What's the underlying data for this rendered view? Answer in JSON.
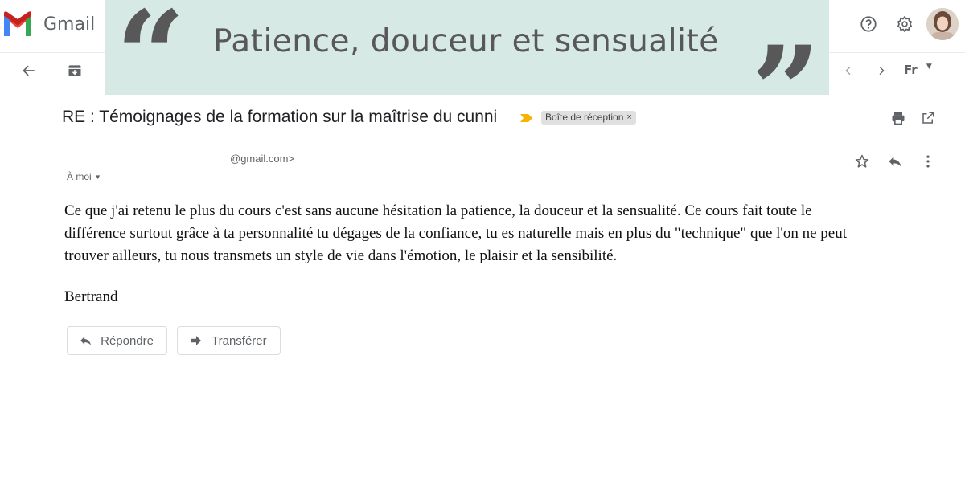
{
  "header": {
    "app_name": "Gmail",
    "language_button": "Fr"
  },
  "banner": {
    "title": "Patience, douceur et sensualité",
    "open_quote": "“",
    "close_quote": "”",
    "background_color": "#d7e9e5",
    "text_color": "#585858"
  },
  "email": {
    "subject": "RE : Témoignages de la formation sur la maîtrise du cunni",
    "label": "Boîte de réception",
    "label_remove": "×",
    "sender": "@gmail.com>",
    "recipient": "À moi",
    "body": "Ce que j'ai retenu le plus du cours c'est sans aucune hésitation la patience, la douceur et la sensualité. Ce cours fait toute le différence surtout grâce à ta personnalité tu dégages de la confiance, tu es naturelle mais en plus du \"technique\" que l'on ne peut trouver ailleurs, tu nous transmets un style de vie dans l'émotion, le plaisir et la sensibilité.",
    "signature": "Bertrand"
  },
  "actions": {
    "reply_label": "Répondre",
    "forward_label": "Transférer"
  },
  "icons": [
    "gmail-logo-icon",
    "help-icon",
    "gear-icon",
    "back-icon",
    "archive-icon",
    "chevron-left-icon",
    "chevron-right-icon",
    "important-icon",
    "print-icon",
    "open-in-new-icon",
    "star-icon",
    "reply-icon",
    "more-vert-icon",
    "forward-icon",
    "caret-down-icon"
  ]
}
